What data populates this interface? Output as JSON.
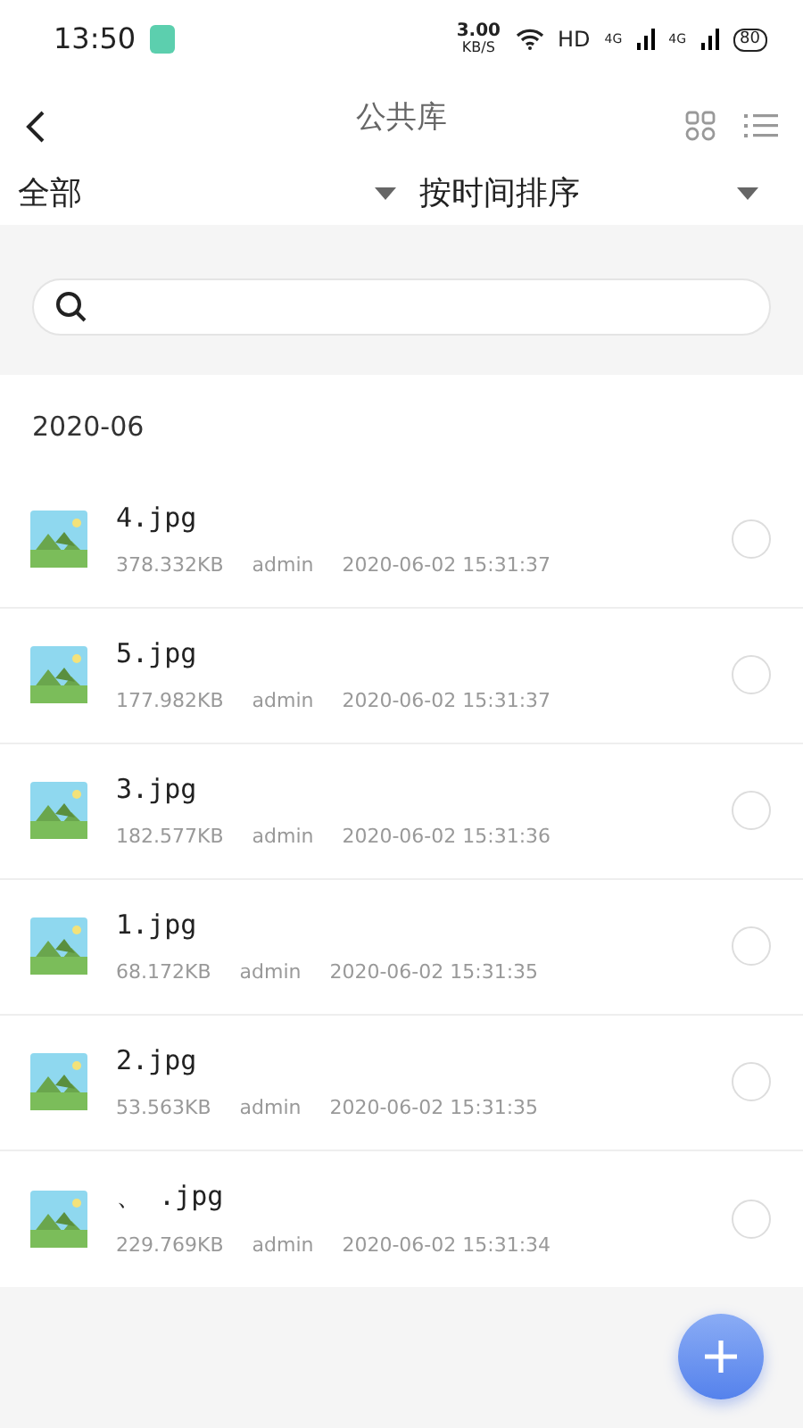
{
  "status_bar": {
    "time": "13:50",
    "speed": "3.00",
    "speed_unit": "KB/S",
    "hd": "HD",
    "network_1": "4G",
    "network_2": "4G",
    "battery": "80"
  },
  "header": {
    "title": "公共库"
  },
  "filters": [
    {
      "label": "全部"
    },
    {
      "label": "按时间排序"
    }
  ],
  "section": {
    "title": "2020-06"
  },
  "files": [
    {
      "name": "4.jpg",
      "size": "378.332KB",
      "owner": "admin",
      "time": "2020-06-02 15:31:37",
      "selected": false
    },
    {
      "name": "5.jpg",
      "size": "177.982KB",
      "owner": "admin",
      "time": "2020-06-02 15:31:37",
      "selected": false
    },
    {
      "name": "3.jpg",
      "size": "182.577KB",
      "owner": "admin",
      "time": "2020-06-02 15:31:36",
      "selected": false
    },
    {
      "name": "1.jpg",
      "size": "68.172KB",
      "owner": "admin",
      "time": "2020-06-02 15:31:35",
      "selected": false
    },
    {
      "name": "2.jpg",
      "size": "53.563KB",
      "owner": "admin",
      "time": "2020-06-02 15:31:35",
      "selected": false
    },
    {
      "name": "、 .jpg",
      "size": "229.769KB",
      "owner": "admin",
      "time": "2020-06-02 15:31:34",
      "selected": false
    }
  ]
}
